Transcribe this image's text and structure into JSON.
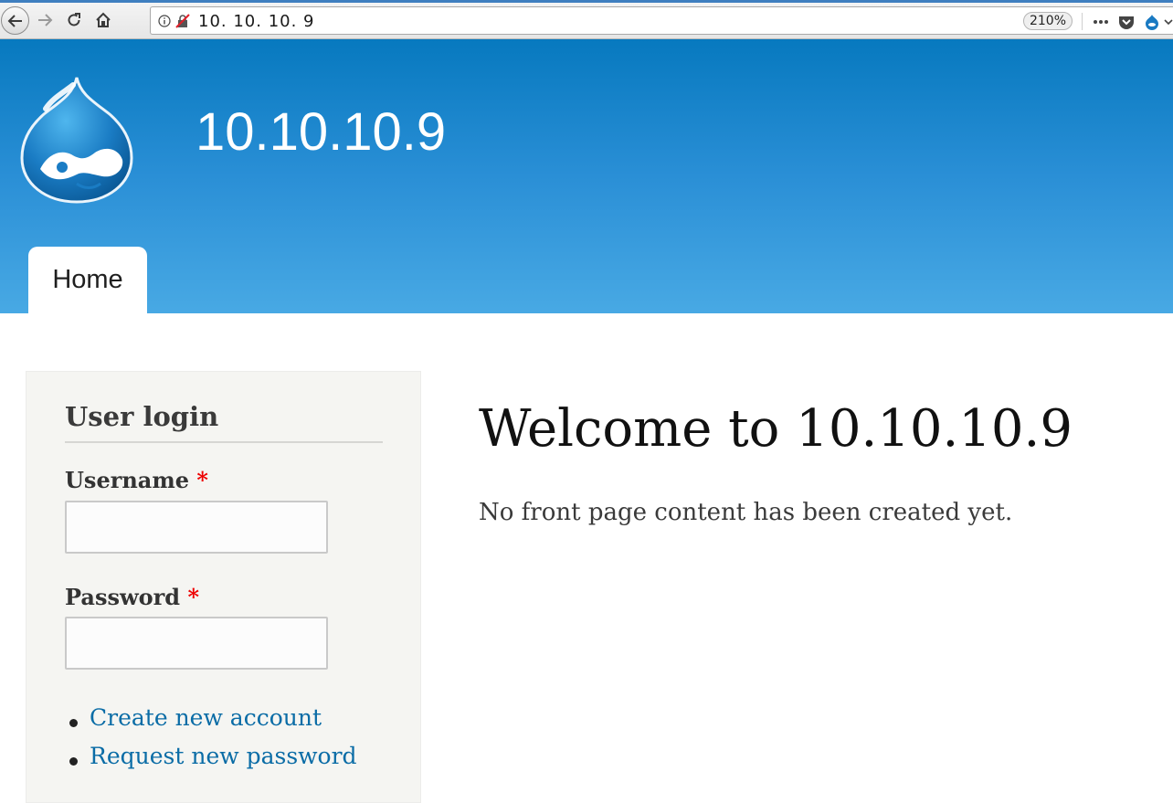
{
  "browser": {
    "url": "10. 10. 10. 9",
    "zoom": "210%"
  },
  "header": {
    "site_name": "10.10.10.9",
    "tabs": [
      {
        "label": "Home"
      }
    ]
  },
  "sidebar": {
    "title": "User login",
    "username_label": "Username",
    "password_label": "Password",
    "required_marker": "*",
    "username_value": "",
    "password_value": "",
    "links": [
      {
        "label": "Create new account"
      },
      {
        "label": "Request new password"
      }
    ]
  },
  "main": {
    "title": "Welcome to 10.10.10.9",
    "text": "No front page content has been created yet."
  },
  "colors": {
    "header_top": "#0779bf",
    "header_bottom": "#48a9e4",
    "link": "#0a6ca6",
    "required": "#e00000",
    "sidebar_bg": "#f5f5f2"
  },
  "icons": [
    "back-arrow-icon",
    "forward-arrow-icon",
    "reload-icon",
    "home-icon",
    "info-icon",
    "insecure-lock-icon",
    "more-icon",
    "pocket-icon",
    "drupal-icon",
    "chevron-down-icon"
  ]
}
